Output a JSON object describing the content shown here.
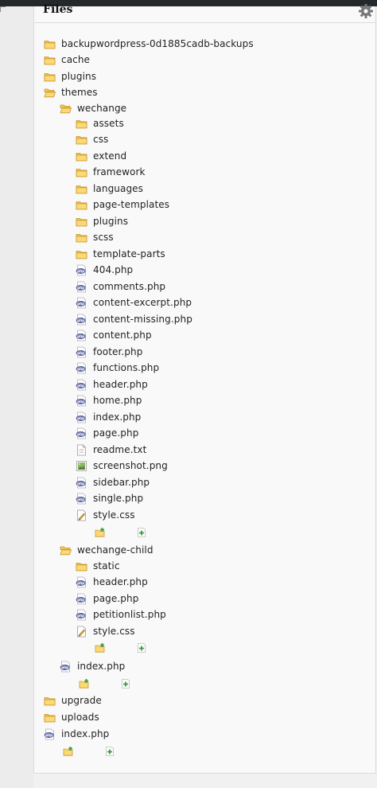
{
  "panel": {
    "title": "Files",
    "settings_icon": "gear-icon"
  },
  "tree": [
    {
      "kind": "folder",
      "label": "backupwordpress-0d1885cadb-backups",
      "depth": 0
    },
    {
      "kind": "folder",
      "label": "cache",
      "depth": 0
    },
    {
      "kind": "folder",
      "label": "plugins",
      "depth": 0
    },
    {
      "kind": "folder-open",
      "label": "themes",
      "depth": 0
    },
    {
      "kind": "folder-open",
      "label": "wechange",
      "depth": 1
    },
    {
      "kind": "folder",
      "label": "assets",
      "depth": 2
    },
    {
      "kind": "folder",
      "label": "css",
      "depth": 2
    },
    {
      "kind": "folder",
      "label": "extend",
      "depth": 2
    },
    {
      "kind": "folder",
      "label": "framework",
      "depth": 2
    },
    {
      "kind": "folder",
      "label": "languages",
      "depth": 2
    },
    {
      "kind": "folder",
      "label": "page-templates",
      "depth": 2
    },
    {
      "kind": "folder",
      "label": "plugins",
      "depth": 2
    },
    {
      "kind": "folder",
      "label": "scss",
      "depth": 2
    },
    {
      "kind": "folder",
      "label": "template-parts",
      "depth": 2
    },
    {
      "kind": "php",
      "label": "404.php",
      "depth": 2
    },
    {
      "kind": "php",
      "label": "comments.php",
      "depth": 2
    },
    {
      "kind": "php",
      "label": "content-excerpt.php",
      "depth": 2
    },
    {
      "kind": "php",
      "label": "content-missing.php",
      "depth": 2
    },
    {
      "kind": "php",
      "label": "content.php",
      "depth": 2
    },
    {
      "kind": "php",
      "label": "footer.php",
      "depth": 2
    },
    {
      "kind": "php",
      "label": "functions.php",
      "depth": 2
    },
    {
      "kind": "php",
      "label": "header.php",
      "depth": 2
    },
    {
      "kind": "php",
      "label": "home.php",
      "depth": 2
    },
    {
      "kind": "php",
      "label": "index.php",
      "depth": 2
    },
    {
      "kind": "php",
      "label": "page.php",
      "depth": 2
    },
    {
      "kind": "txt",
      "label": "readme.txt",
      "depth": 2
    },
    {
      "kind": "png",
      "label": "screenshot.png",
      "depth": 2
    },
    {
      "kind": "php",
      "label": "sidebar.php",
      "depth": 2
    },
    {
      "kind": "php",
      "label": "single.php",
      "depth": 2
    },
    {
      "kind": "css",
      "label": "style.css",
      "depth": 2
    },
    {
      "kind": "add",
      "depth": 2
    },
    {
      "kind": "folder-open",
      "label": "wechange-child",
      "depth": 1
    },
    {
      "kind": "folder",
      "label": "static",
      "depth": 2
    },
    {
      "kind": "php",
      "label": "header.php",
      "depth": 2
    },
    {
      "kind": "php",
      "label": "page.php",
      "depth": 2
    },
    {
      "kind": "php",
      "label": "petitionlist.php",
      "depth": 2
    },
    {
      "kind": "css",
      "label": "style.css",
      "depth": 2
    },
    {
      "kind": "add",
      "depth": 2
    },
    {
      "kind": "php",
      "label": "index.php",
      "depth": 1
    },
    {
      "kind": "add",
      "depth": 1
    },
    {
      "kind": "folder",
      "label": "upgrade",
      "depth": 0
    },
    {
      "kind": "folder",
      "label": "uploads",
      "depth": 0
    },
    {
      "kind": "php",
      "label": "index.php",
      "depth": 0
    },
    {
      "kind": "add",
      "depth": 0
    }
  ]
}
